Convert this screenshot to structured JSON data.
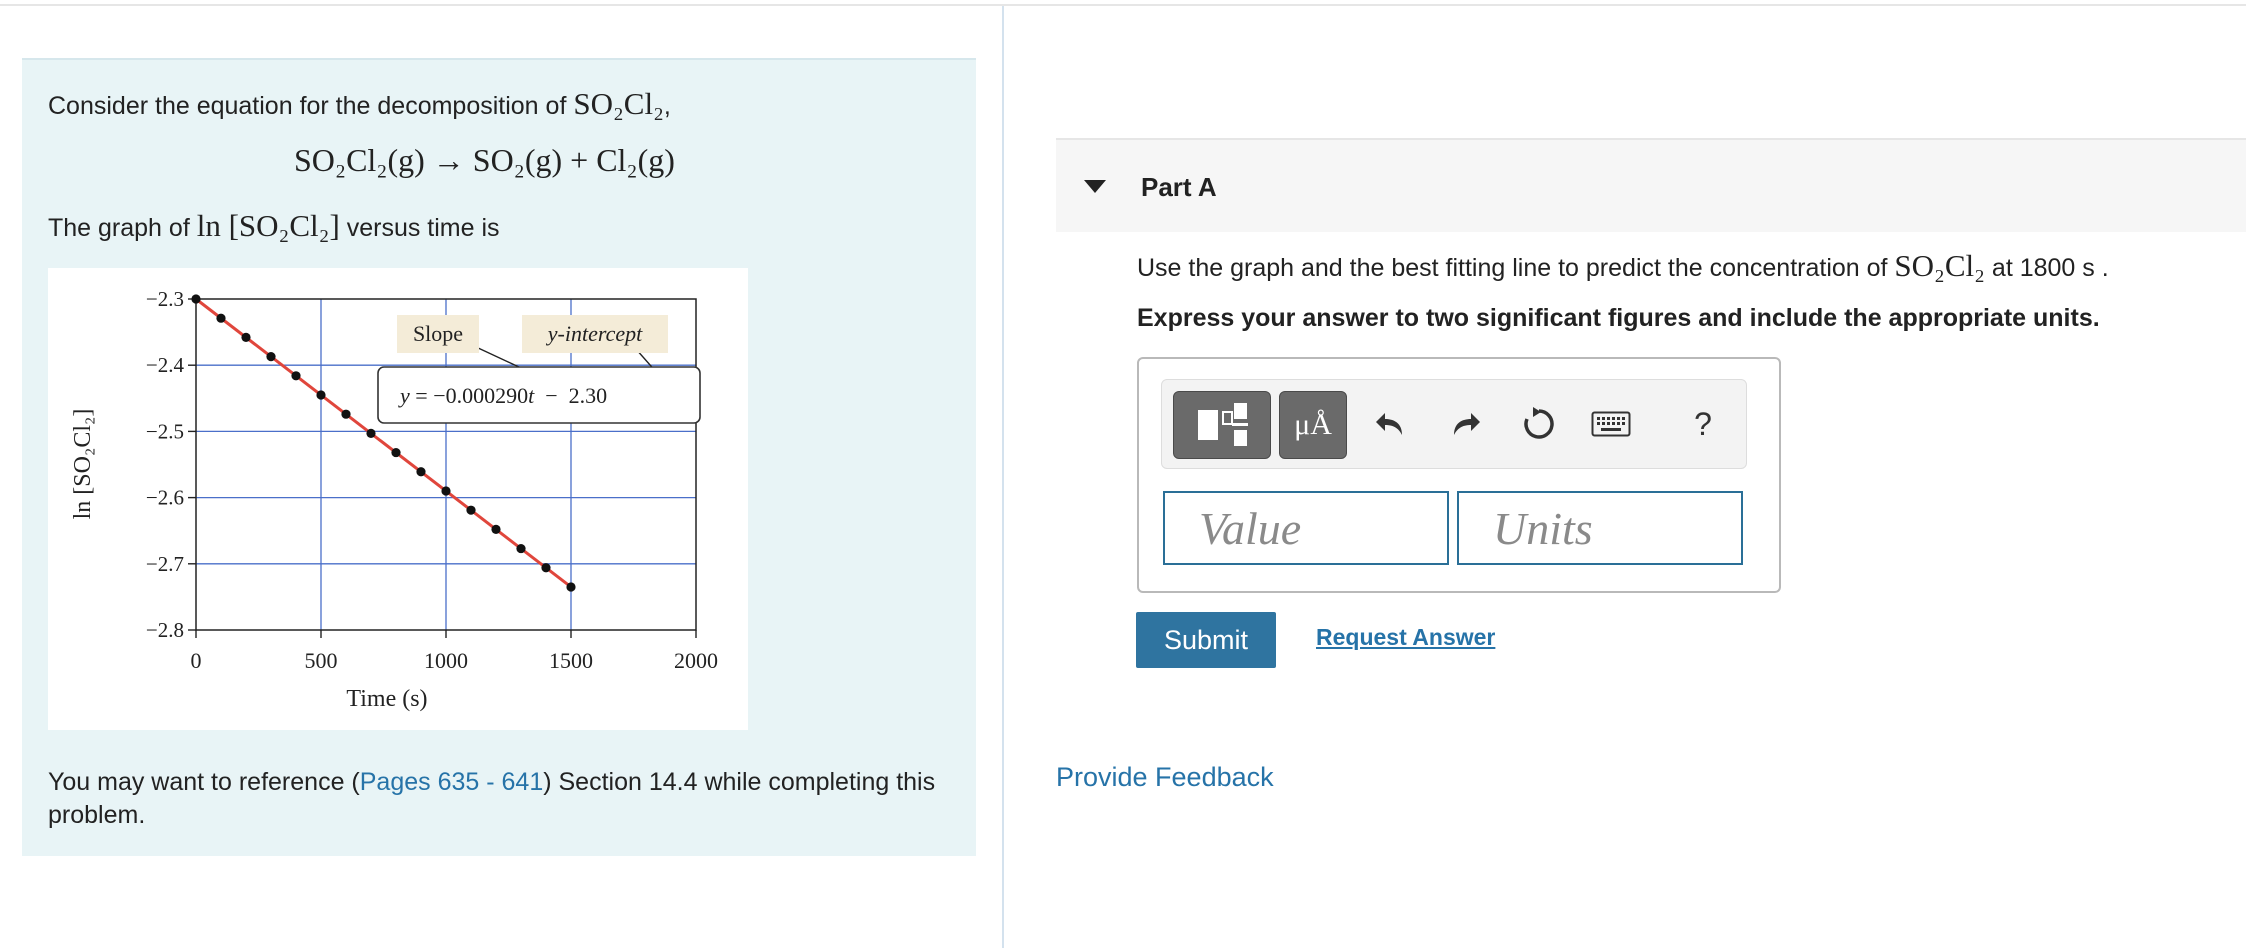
{
  "intro": {
    "line1_prefix": "Consider the equation for the decomposition of ",
    "line1_formula": "SO₂Cl₂",
    "line1_suffix": ",",
    "equation": "SO₂Cl₂(g) → SO₂(g) + Cl₂(g)",
    "graph_prefix": "The graph of ",
    "graph_formula": "ln [SO₂Cl₂]",
    "graph_suffix": " versus time is"
  },
  "chart_data": {
    "type": "scatter",
    "xlabel": "Time (s)",
    "ylabel": "ln [SO₂Cl₂]",
    "xlim": [
      0,
      2000
    ],
    "ylim": [
      -2.8,
      -2.3
    ],
    "xticks": [
      0,
      500,
      1000,
      1500,
      2000
    ],
    "yticks": [
      -2.3,
      -2.4,
      -2.5,
      -2.6,
      -2.7,
      -2.8
    ],
    "xtick_labels": [
      "0",
      "500",
      "1000",
      "1500",
      "2000"
    ],
    "ytick_labels": [
      "−2.3",
      "−2.4",
      "−2.5",
      "−2.6",
      "−2.7",
      "−2.8"
    ],
    "grid": true,
    "points": [
      {
        "x": 0,
        "y": -2.3
      },
      {
        "x": 100,
        "y": -2.329
      },
      {
        "x": 200,
        "y": -2.358
      },
      {
        "x": 300,
        "y": -2.387
      },
      {
        "x": 400,
        "y": -2.416
      },
      {
        "x": 500,
        "y": -2.445
      },
      {
        "x": 600,
        "y": -2.474
      },
      {
        "x": 700,
        "y": -2.503
      },
      {
        "x": 800,
        "y": -2.532
      },
      {
        "x": 900,
        "y": -2.561
      },
      {
        "x": 1000,
        "y": -2.59
      },
      {
        "x": 1100,
        "y": -2.619
      },
      {
        "x": 1200,
        "y": -2.648
      },
      {
        "x": 1300,
        "y": -2.677
      },
      {
        "x": 1400,
        "y": -2.706
      },
      {
        "x": 1500,
        "y": -2.735
      }
    ],
    "fit_line": {
      "slope": -0.00029,
      "intercept": -2.3,
      "x_range": [
        0,
        1500
      ],
      "color": "#e0463c"
    },
    "annotation": {
      "slope_label": "Slope",
      "intercept_label": "y-intercept",
      "equation_y": "y",
      "equation_eq": " = ",
      "equation_slope": "−0.000290",
      "equation_t": "t",
      "equation_minus": "  −  ",
      "equation_intercept": "2.30"
    }
  },
  "reference": {
    "prefix": "You may want to reference (",
    "link": "Pages 635 - 641",
    "suffix": ") Section 14.4 while completing this problem."
  },
  "part": {
    "title": "Part A",
    "question_prefix": "Use the graph and the best fitting line to predict the concentration of ",
    "question_formula": "SO₂Cl₂",
    "question_suffix": " at 1800 s .",
    "instruction": "Express your answer to two significant figures and include the appropriate units."
  },
  "toolbar": {
    "units_button": "μÅ",
    "help_button": "?",
    "icons": [
      "templates-icon",
      "units-icon",
      "undo-icon",
      "redo-icon",
      "reset-icon",
      "keyboard-icon",
      "help-icon"
    ]
  },
  "answer": {
    "value_placeholder": "Value",
    "units_placeholder": "Units",
    "value": "",
    "units": ""
  },
  "actions": {
    "submit": "Submit",
    "request_answer": "Request Answer",
    "feedback": "Provide Feedback"
  },
  "colors": {
    "panel_bg": "#e8f4f6",
    "link": "#2673a8",
    "submit_bg": "#2f74a0",
    "grid_blue": "#4a6fc9",
    "fit_line": "#e0463c",
    "annotation_bg": "#f4ecd8"
  }
}
